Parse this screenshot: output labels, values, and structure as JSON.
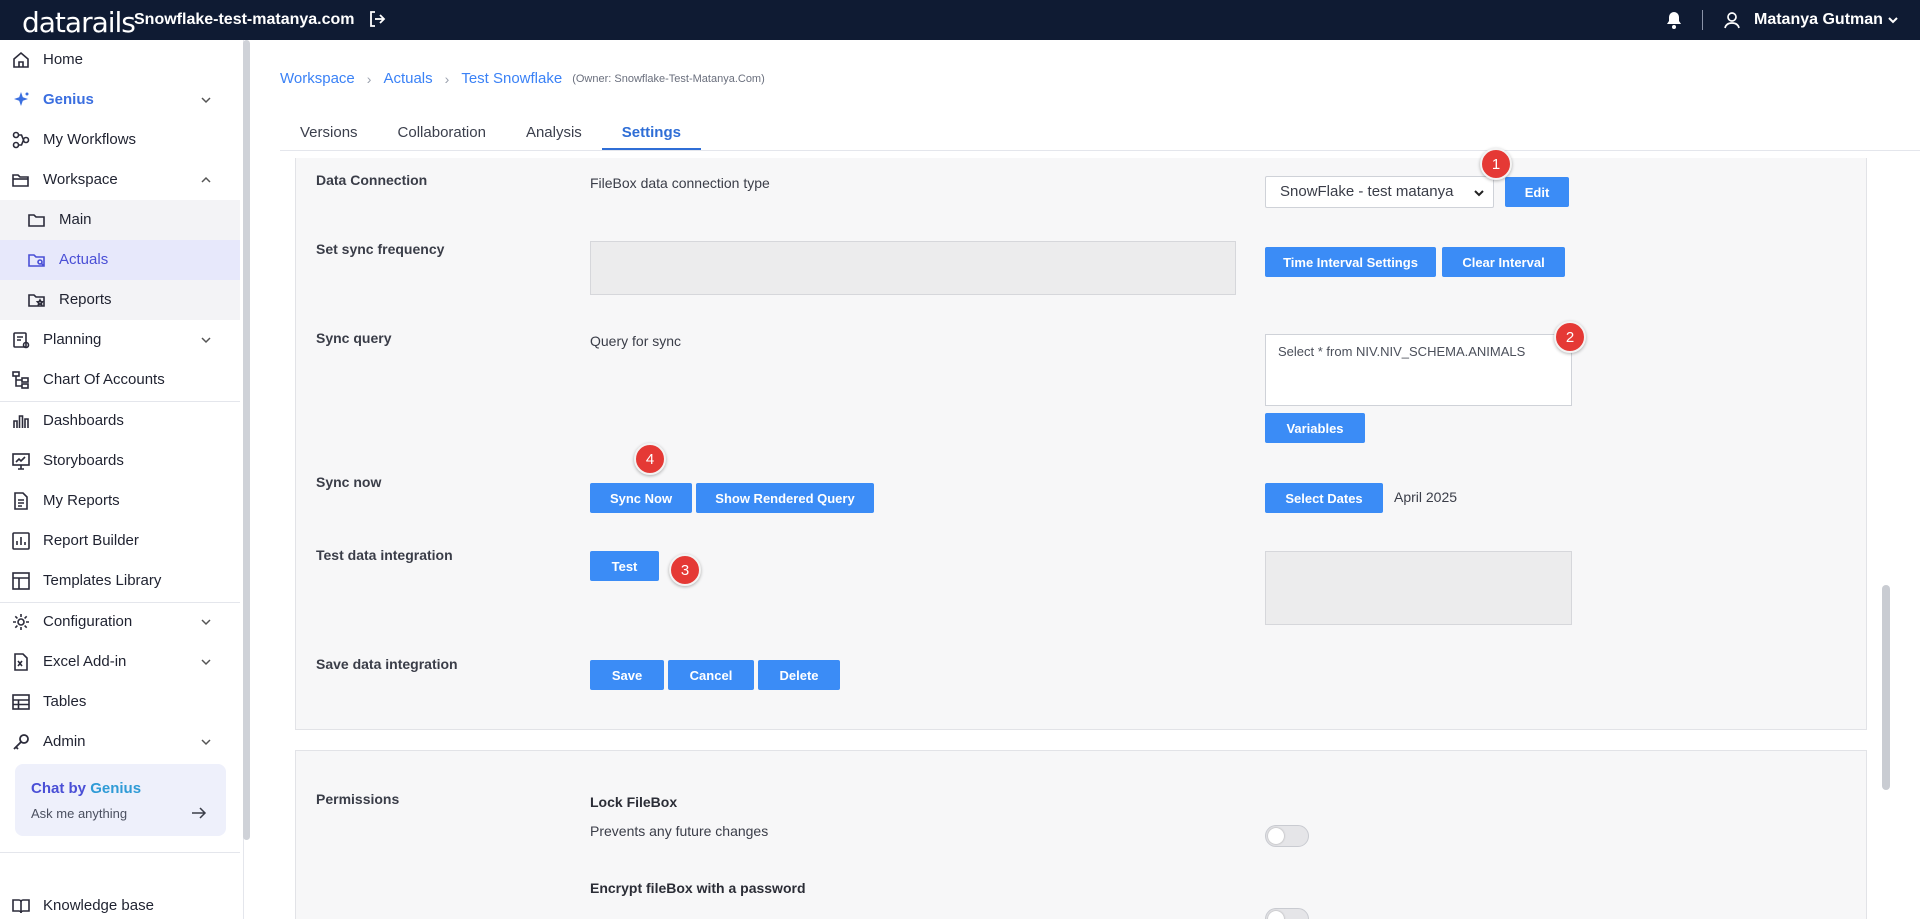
{
  "topbar": {
    "logo": "datarails",
    "env_name": "Snowflake-test-matanya.com",
    "user_name": "Matanya Gutman"
  },
  "sidebar": {
    "items": [
      {
        "label": "Home",
        "icon": "home-icon"
      },
      {
        "label": "Genius",
        "icon": "sparkle-icon"
      },
      {
        "label": "My Workflows",
        "icon": "workflow-icon"
      },
      {
        "label": "Workspace",
        "icon": "folder-open-icon"
      },
      {
        "label": "Main",
        "icon": "folder-icon"
      },
      {
        "label": "Actuals",
        "icon": "folder-search-icon"
      },
      {
        "label": "Reports",
        "icon": "folder-star-icon"
      },
      {
        "label": "Planning",
        "icon": "planning-icon"
      },
      {
        "label": "Chart Of Accounts",
        "icon": "tree-icon"
      },
      {
        "label": "Dashboards",
        "icon": "bar-chart-icon"
      },
      {
        "label": "Storyboards",
        "icon": "presentation-icon"
      },
      {
        "label": "My Reports",
        "icon": "document-icon"
      },
      {
        "label": "Report Builder",
        "icon": "report-builder-icon"
      },
      {
        "label": "Templates Library",
        "icon": "templates-icon"
      },
      {
        "label": "Configuration",
        "icon": "gear-icon"
      },
      {
        "label": "Excel Add-in",
        "icon": "excel-icon"
      },
      {
        "label": "Tables",
        "icon": "table-icon"
      },
      {
        "label": "Admin",
        "icon": "key-icon"
      },
      {
        "label": "Knowledge base",
        "icon": "book-icon"
      }
    ],
    "chat": {
      "title_prefix": "Chat by ",
      "title_brand": "Genius",
      "subtitle": "Ask me anything"
    }
  },
  "breadcrumb": {
    "items": [
      "Workspace",
      "Actuals",
      "Test Snowflake"
    ],
    "owner": "(Owner: Snowflake-Test-Matanya.Com)"
  },
  "tabs": [
    "Versions",
    "Collaboration",
    "Analysis",
    "Settings"
  ],
  "settings": {
    "data_connection": {
      "label": "Data Connection",
      "description": "FileBox data connection type",
      "selected": "SnowFlake - test matanya",
      "edit_button": "Edit"
    },
    "sync_frequency": {
      "label": "Set sync frequency",
      "time_interval_button": "Time Interval Settings",
      "clear_interval_button": "Clear Interval"
    },
    "sync_query": {
      "label": "Sync query",
      "description": "Query for sync",
      "query": "Select * from NIV.NIV_SCHEMA.ANIMALS",
      "variables_button": "Variables"
    },
    "sync_now": {
      "label": "Sync now",
      "sync_button": "Sync Now",
      "rendered_button": "Show Rendered Query",
      "select_dates_button": "Select Dates",
      "selected_date": "April 2025"
    },
    "test_integration": {
      "label": "Test data integration",
      "test_button": "Test"
    },
    "save_integration": {
      "label": "Save data integration",
      "save_button": "Save",
      "cancel_button": "Cancel",
      "delete_button": "Delete"
    }
  },
  "permissions": {
    "label": "Permissions",
    "lock_title": "Lock FileBox",
    "lock_description": "Prevents any future changes",
    "encrypt_title": "Encrypt fileBox with a password"
  },
  "markers": [
    "1",
    "2",
    "3",
    "4"
  ],
  "colors": {
    "topbar": "#0f1b33",
    "accent": "#3b8cf6",
    "marker": "#e53935"
  }
}
